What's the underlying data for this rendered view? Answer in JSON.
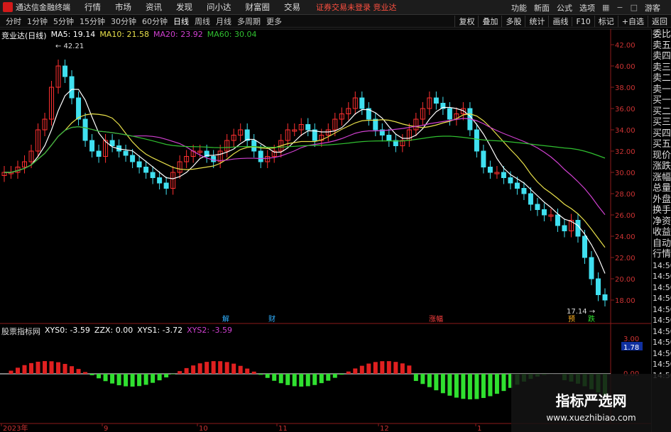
{
  "titlebar": {
    "app_name": "通达信金融终端",
    "menu": [
      "行情",
      "市场",
      "资讯",
      "发现",
      "问小达",
      "财富圈",
      "交易"
    ],
    "notice": "证券交易未登录  竞业达",
    "right": [
      "功能",
      "新面",
      "公式",
      "选项",
      "游客"
    ]
  },
  "toolbar": {
    "periods": [
      "分时",
      "1分钟",
      "5分钟",
      "15分钟",
      "30分钟",
      "60分钟",
      "日线",
      "周线",
      "月线",
      "多周期",
      "更多"
    ],
    "active": "日线",
    "right": [
      "复权",
      "叠加",
      "多股",
      "统计",
      "画线",
      "F10",
      "标记",
      "+自选",
      "返回"
    ]
  },
  "chart": {
    "stock": "竞业达(日线)",
    "ma": [
      {
        "label": "MA5: 19.14",
        "color": "#ffffff"
      },
      {
        "label": "MA10: 21.58",
        "color": "#e8e04a"
      },
      {
        "label": "MA20: 23.92",
        "color": "#d040d0"
      },
      {
        "label": "MA60: 30.04",
        "color": "#30c030"
      }
    ],
    "yticks": [
      "42.00",
      "40.00",
      "38.00",
      "36.00",
      "34.00",
      "32.00",
      "30.00",
      "28.00",
      "26.00",
      "24.00",
      "22.00",
      "20.00",
      "18.00"
    ],
    "high_label": "42.21",
    "low_label": "17.14",
    "events": [
      {
        "label": "解",
        "color": "#30b0ff"
      },
      {
        "label": "财",
        "color": "#30b0ff"
      },
      {
        "label": "涨幅",
        "color": "#ff4040"
      },
      {
        "label": "预",
        "color": "#ffb020"
      },
      {
        "label": "跌",
        "color": "#30e030"
      }
    ]
  },
  "indicator": {
    "name": "股票指标网",
    "xys0": "XYS0: -3.59",
    "zzx": "ZZX: 0.00",
    "xys1": "XYS1: -3.72",
    "xys2": "XYS2: -3.59",
    "yticks": [
      "3.00",
      "1.78",
      "0.00"
    ],
    "current": "1.78"
  },
  "xaxis": [
    "2023年",
    "9",
    "10",
    "11",
    "12",
    "1"
  ],
  "side": [
    "委比",
    "卖五",
    "卖四",
    "卖三",
    "卖二",
    "卖一",
    "买一",
    "买二",
    "买三",
    "买四",
    "买五",
    "现价",
    "涨跌",
    "涨幅",
    "总量",
    "外盘",
    "换手",
    "净资",
    "收益",
    "自动",
    "行情",
    "14:50",
    "14:50",
    "14:50",
    "14:50",
    "14:50",
    "14:50",
    "14:50",
    "14:50",
    "14:50",
    "14:50",
    "14:50"
  ],
  "watermark": {
    "title": "指标严选网",
    "url": "www.xuezhibiao.com"
  },
  "colors": {
    "up": "#ff3030",
    "down": "#40e0f0",
    "bg": "#000000"
  }
}
